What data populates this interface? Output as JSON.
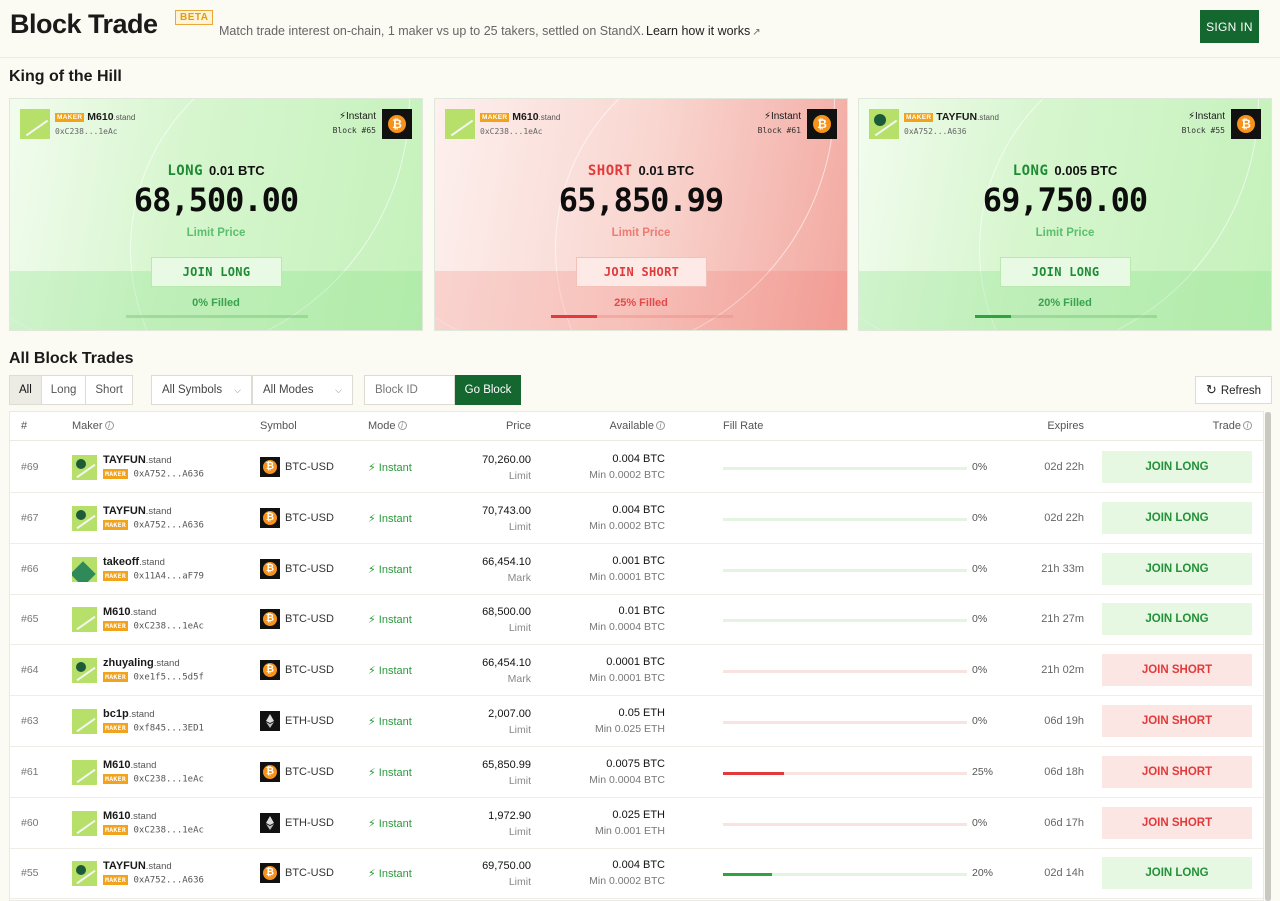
{
  "header": {
    "title": "Block Trade",
    "beta": "BETA",
    "subtitle": "Match trade interest on-chain, 1 maker vs up to 25 takers, settled on StandX.",
    "learn_link": "Learn how it works",
    "sign_in": "SIGN IN"
  },
  "koth": {
    "title": "King of the Hill",
    "cards": [
      {
        "side": "LONG",
        "qty": "0.01 BTC",
        "price": "68,500.00",
        "price_label": "Limit Price",
        "join": "JOIN LONG",
        "filled": "0% Filled",
        "fill_fraction": 0.0,
        "maker_badge": "MAKER",
        "maker_name": "M610",
        "maker_suffix": ".stand",
        "maker_addr": "0xC238...1eAc",
        "mode": "Instant",
        "block": "Block #65"
      },
      {
        "side": "SHORT",
        "qty": "0.01 BTC",
        "price": "65,850.99",
        "price_label": "Limit Price",
        "join": "JOIN SHORT",
        "filled": "25% Filled",
        "fill_fraction": 0.25,
        "maker_badge": "MAKER",
        "maker_name": "M610",
        "maker_suffix": ".stand",
        "maker_addr": "0xC238...1eAc",
        "mode": "Instant",
        "block": "Block #61"
      },
      {
        "side": "LONG",
        "qty": "0.005 BTC",
        "price": "69,750.00",
        "price_label": "Limit Price",
        "join": "JOIN LONG",
        "filled": "20% Filled",
        "fill_fraction": 0.2,
        "maker_badge": "MAKER",
        "maker_name": "TAYFUN",
        "maker_suffix": ".stand",
        "maker_addr": "0xA752...A636",
        "mode": "Instant",
        "block": "Block #55"
      }
    ]
  },
  "all": {
    "title": "All Block Trades",
    "side_filters": [
      "All",
      "Long",
      "Short"
    ],
    "symbols_dropdown": "All Symbols",
    "modes_dropdown": "All Modes",
    "block_id_placeholder": "Block ID",
    "go_block": "Go Block",
    "refresh": "Refresh",
    "columns": {
      "num": "#",
      "maker": "Maker",
      "symbol": "Symbol",
      "mode": "Mode",
      "price": "Price",
      "available": "Available",
      "fill_rate": "Fill Rate",
      "expires": "Expires",
      "trade": "Trade"
    },
    "rows": [
      {
        "num": "#69",
        "name": "TAYFUN",
        "suffix": ".stand",
        "badge": "MAKER",
        "addr": "0xA752...A636",
        "coin": "BTC",
        "symbol": "BTC-USD",
        "mode": "Instant",
        "price": "70,260.00",
        "ptype": "Limit",
        "avail": "0.004 BTC",
        "min": "Min 0.0002 BTC",
        "fill": 0.0,
        "pct": "0%",
        "expires": "02d 22h",
        "trade": "JOIN LONG",
        "side": "long",
        "avatar": "dot"
      },
      {
        "num": "#67",
        "name": "TAYFUN",
        "suffix": ".stand",
        "badge": "MAKER",
        "addr": "0xA752...A636",
        "coin": "BTC",
        "symbol": "BTC-USD",
        "mode": "Instant",
        "price": "70,743.00",
        "ptype": "Limit",
        "avail": "0.004 BTC",
        "min": "Min 0.0002 BTC",
        "fill": 0.0,
        "pct": "0%",
        "expires": "02d 22h",
        "trade": "JOIN LONG",
        "side": "long",
        "avatar": "dot"
      },
      {
        "num": "#66",
        "name": "takeoff",
        "suffix": ".stand",
        "badge": "MAKER",
        "addr": "0x11A4...aF79",
        "coin": "BTC",
        "symbol": "BTC-USD",
        "mode": "Instant",
        "price": "66,454.10",
        "ptype": "Mark",
        "avail": "0.001 BTC",
        "min": "Min 0.0001 BTC",
        "fill": 0.0,
        "pct": "0%",
        "expires": "21h 33m",
        "trade": "JOIN LONG",
        "side": "long",
        "avatar": "hill"
      },
      {
        "num": "#65",
        "name": "M610",
        "suffix": ".stand",
        "badge": "MAKER",
        "addr": "0xC238...1eAc",
        "coin": "BTC",
        "symbol": "BTC-USD",
        "mode": "Instant",
        "price": "68,500.00",
        "ptype": "Limit",
        "avail": "0.01 BTC",
        "min": "Min 0.0004 BTC",
        "fill": 0.0,
        "pct": "0%",
        "expires": "21h 27m",
        "trade": "JOIN LONG",
        "side": "long",
        "avatar": "plain"
      },
      {
        "num": "#64",
        "name": "zhuyaling",
        "suffix": ".stand",
        "badge": "MAKER",
        "addr": "0xe1f5...5d5f",
        "coin": "BTC",
        "symbol": "BTC-USD",
        "mode": "Instant",
        "price": "66,454.10",
        "ptype": "Mark",
        "avail": "0.0001 BTC",
        "min": "Min 0.0001 BTC",
        "fill": 0.0,
        "pct": "0%",
        "expires": "21h 02m",
        "trade": "JOIN SHORT",
        "side": "short",
        "avatar": "dot"
      },
      {
        "num": "#63",
        "name": "bc1p",
        "suffix": ".stand",
        "badge": "MAKER",
        "addr": "0xf845...3ED1",
        "coin": "ETH",
        "symbol": "ETH-USD",
        "mode": "Instant",
        "price": "2,007.00",
        "ptype": "Limit",
        "avail": "0.05 ETH",
        "min": "Min 0.025 ETH",
        "fill": 0.0,
        "pct": "0%",
        "expires": "06d 19h",
        "trade": "JOIN SHORT",
        "side": "short",
        "avatar": "plain"
      },
      {
        "num": "#61",
        "name": "M610",
        "suffix": ".stand",
        "badge": "MAKER",
        "addr": "0xC238...1eAc",
        "coin": "BTC",
        "symbol": "BTC-USD",
        "mode": "Instant",
        "price": "65,850.99",
        "ptype": "Limit",
        "avail": "0.0075 BTC",
        "min": "Min 0.0004 BTC",
        "fill": 0.25,
        "pct": "25%",
        "expires": "06d 18h",
        "trade": "JOIN SHORT",
        "side": "short",
        "avatar": "plain"
      },
      {
        "num": "#60",
        "name": "M610",
        "suffix": ".stand",
        "badge": "MAKER",
        "addr": "0xC238...1eAc",
        "coin": "ETH",
        "symbol": "ETH-USD",
        "mode": "Instant",
        "price": "1,972.90",
        "ptype": "Limit",
        "avail": "0.025 ETH",
        "min": "Min 0.001 ETH",
        "fill": 0.0,
        "pct": "0%",
        "expires": "06d 17h",
        "trade": "JOIN SHORT",
        "side": "short",
        "avatar": "plain"
      },
      {
        "num": "#55",
        "name": "TAYFUN",
        "suffix": ".stand",
        "badge": "MAKER",
        "addr": "0xA752...A636",
        "coin": "BTC",
        "symbol": "BTC-USD",
        "mode": "Instant",
        "price": "69,750.00",
        "ptype": "Limit",
        "avail": "0.004 BTC",
        "min": "Min 0.0002 BTC",
        "fill": 0.2,
        "pct": "20%",
        "expires": "02d 14h",
        "trade": "JOIN LONG",
        "side": "long",
        "avatar": "dot"
      }
    ]
  },
  "colors": {
    "brand_green": "#14672f",
    "long_green": "#1f8b35",
    "short_red": "#e23a3a",
    "maker_orange": "#f2a31b",
    "btc_orange": "#f7931a"
  }
}
